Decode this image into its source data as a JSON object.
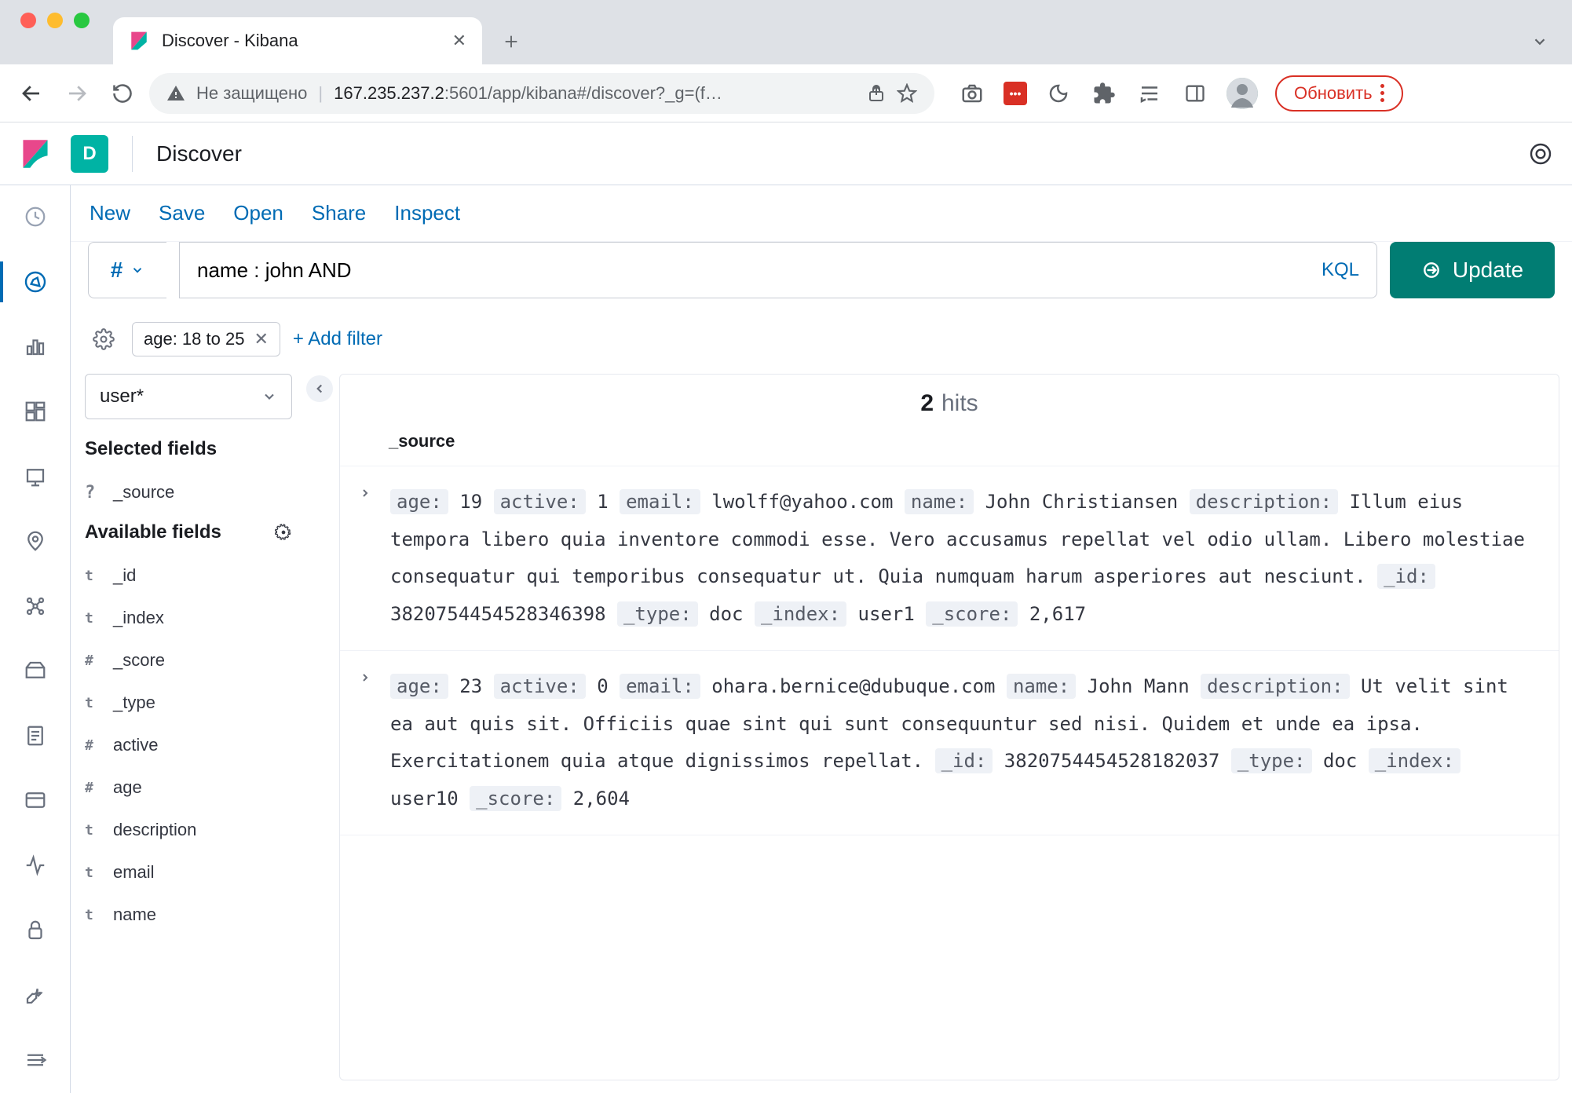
{
  "browser": {
    "tab_title": "Discover - Kibana",
    "url_security": "Не защищено",
    "url_host": "167.235.237.2",
    "url_path": ":5601/app/kibana#/discover?_g=(f…",
    "update_label": "Обновить"
  },
  "header": {
    "space_letter": "D",
    "page_title": "Discover"
  },
  "toolbar": {
    "new": "New",
    "save": "Save",
    "open": "Open",
    "share": "Share",
    "inspect": "Inspect"
  },
  "query": {
    "value": "name : john AND",
    "lang": "KQL",
    "update_label": "Update"
  },
  "filters": {
    "pill_label": "age: 18 to 25",
    "add_filter": "+ Add filter"
  },
  "index": {
    "selected": "user*"
  },
  "fields": {
    "selected_heading": "Selected fields",
    "available_heading": "Available fields",
    "selected": [
      {
        "type": "?",
        "name": "_source"
      }
    ],
    "available": [
      {
        "type": "t",
        "name": "_id"
      },
      {
        "type": "t",
        "name": "_index"
      },
      {
        "type": "#",
        "name": "_score"
      },
      {
        "type": "t",
        "name": "_type"
      },
      {
        "type": "#",
        "name": "active"
      },
      {
        "type": "#",
        "name": "age"
      },
      {
        "type": "t",
        "name": "description"
      },
      {
        "type": "t",
        "name": "email"
      },
      {
        "type": "t",
        "name": "name"
      }
    ]
  },
  "results": {
    "hits_count": "2",
    "hits_label": "hits",
    "column": "_source",
    "docs": [
      {
        "age": "19",
        "active": "1",
        "email": "lwolff@yahoo.com",
        "name": "John Christiansen",
        "description": "Illum eius tempora libero quia inventore commodi esse. Vero accusamus repellat vel odio ullam. Libero molestiae consequatur qui temporibus consequatur ut. Quia numquam harum asperiores aut nesciunt.",
        "_id": "3820754454528346398",
        "_type": "doc",
        "_index": "user1",
        "_score": "2,617"
      },
      {
        "age": "23",
        "active": "0",
        "email": "ohara.bernice@dubuque.com",
        "name": "John Mann",
        "description": "Ut velit sint ea aut quis sit. Officiis quae sint qui sunt consequuntur sed nisi. Quidem et unde ea ipsa. Exercitationem quia atque dignissimos repellat.",
        "_id": "3820754454528182037",
        "_type": "doc",
        "_index": "user10",
        "_score": "2,604"
      }
    ]
  }
}
